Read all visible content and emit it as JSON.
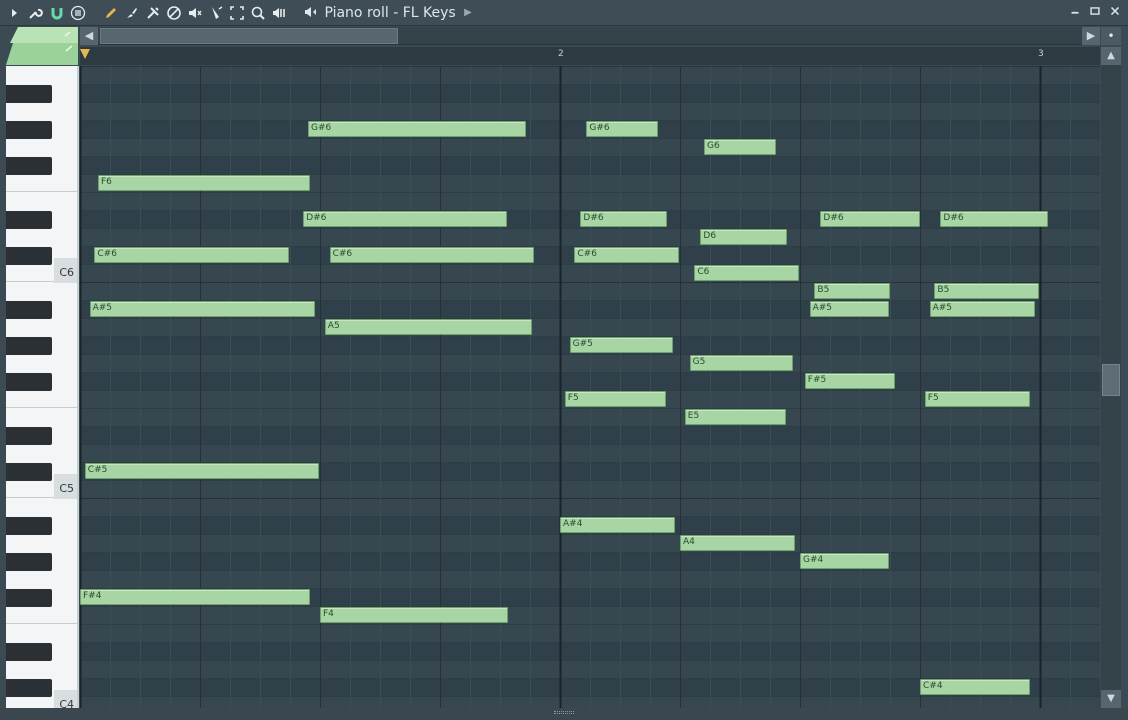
{
  "window": {
    "title": "Piano roll - FL Keys",
    "minimize": "▬",
    "maximize": "■",
    "close": "✕"
  },
  "toolbar": {
    "icons": [
      "play-menu-arrow-icon",
      "wrench-icon",
      "magnet-icon",
      "menu-lines-icon",
      "pencil-icon",
      "brush-icon",
      "delete-tool-icon",
      "mute-tool-icon",
      "slice-tool-icon",
      "select-tool-icon",
      "zoom-icon",
      "playback-icon",
      "speaker-icon"
    ]
  },
  "timeline": {
    "bars": [
      "2",
      "3"
    ]
  },
  "keyboard": {
    "octave_labels": [
      "C6",
      "C5",
      "C4"
    ]
  },
  "notes": [
    {
      "label": "G#6",
      "pitch": 92,
      "start": 1.9,
      "length": 1.82
    },
    {
      "label": "G#6",
      "pitch": 92,
      "start": 4.22,
      "length": 0.6
    },
    {
      "label": "G6",
      "pitch": 91,
      "start": 5.2,
      "length": 0.6
    },
    {
      "label": "F6",
      "pitch": 89,
      "start": 0.15,
      "length": 1.77
    },
    {
      "label": "D#6",
      "pitch": 87,
      "start": 1.86,
      "length": 1.7
    },
    {
      "label": "D#6",
      "pitch": 87,
      "start": 4.17,
      "length": 0.72
    },
    {
      "label": "D#6",
      "pitch": 87,
      "start": 6.17,
      "length": 0.83
    },
    {
      "label": "D#6",
      "pitch": 87,
      "start": 7.17,
      "length": 0.9
    },
    {
      "label": "D6",
      "pitch": 86,
      "start": 5.17,
      "length": 0.72
    },
    {
      "label": "C#6",
      "pitch": 85,
      "start": 0.12,
      "length": 1.62
    },
    {
      "label": "C#6",
      "pitch": 85,
      "start": 2.08,
      "length": 1.7
    },
    {
      "label": "C#6",
      "pitch": 85,
      "start": 4.12,
      "length": 0.87
    },
    {
      "label": "C6",
      "pitch": 84,
      "start": 5.12,
      "length": 0.87
    },
    {
      "label": "B5",
      "pitch": 83,
      "start": 6.12,
      "length": 0.63
    },
    {
      "label": "B5",
      "pitch": 83,
      "start": 7.12,
      "length": 0.87
    },
    {
      "label": "A#5",
      "pitch": 82,
      "start": 0.08,
      "length": 1.88
    },
    {
      "label": "A#5",
      "pitch": 82,
      "start": 6.08,
      "length": 0.66
    },
    {
      "label": "A#5",
      "pitch": 82,
      "start": 7.08,
      "length": 0.88
    },
    {
      "label": "A5",
      "pitch": 81,
      "start": 2.04,
      "length": 1.73
    },
    {
      "label": "G#5",
      "pitch": 80,
      "start": 4.08,
      "length": 0.86
    },
    {
      "label": "G5",
      "pitch": 79,
      "start": 5.08,
      "length": 0.86
    },
    {
      "label": "F#5",
      "pitch": 78,
      "start": 6.04,
      "length": 0.75
    },
    {
      "label": "F5",
      "pitch": 77,
      "start": 4.04,
      "length": 0.84
    },
    {
      "label": "F5",
      "pitch": 77,
      "start": 7.04,
      "length": 0.88
    },
    {
      "label": "E5",
      "pitch": 76,
      "start": 5.04,
      "length": 0.84
    },
    {
      "label": "C#5",
      "pitch": 73,
      "start": 0.04,
      "length": 1.95
    },
    {
      "label": "A#4",
      "pitch": 70,
      "start": 4.0,
      "length": 0.96
    },
    {
      "label": "A4",
      "pitch": 69,
      "start": 5.0,
      "length": 0.96
    },
    {
      "label": "G#4",
      "pitch": 68,
      "start": 6.0,
      "length": 0.74
    },
    {
      "label": "F#4",
      "pitch": 66,
      "start": 0.0,
      "length": 1.92
    },
    {
      "label": "F4",
      "pitch": 65,
      "start": 2.0,
      "length": 1.57
    },
    {
      "label": "C#4",
      "pitch": 61,
      "start": 7.0,
      "length": 0.92
    }
  ],
  "colors": {
    "note_fill": "#a7d5a4",
    "grid_bg": "#34454e",
    "accent": "#e5b64d"
  }
}
